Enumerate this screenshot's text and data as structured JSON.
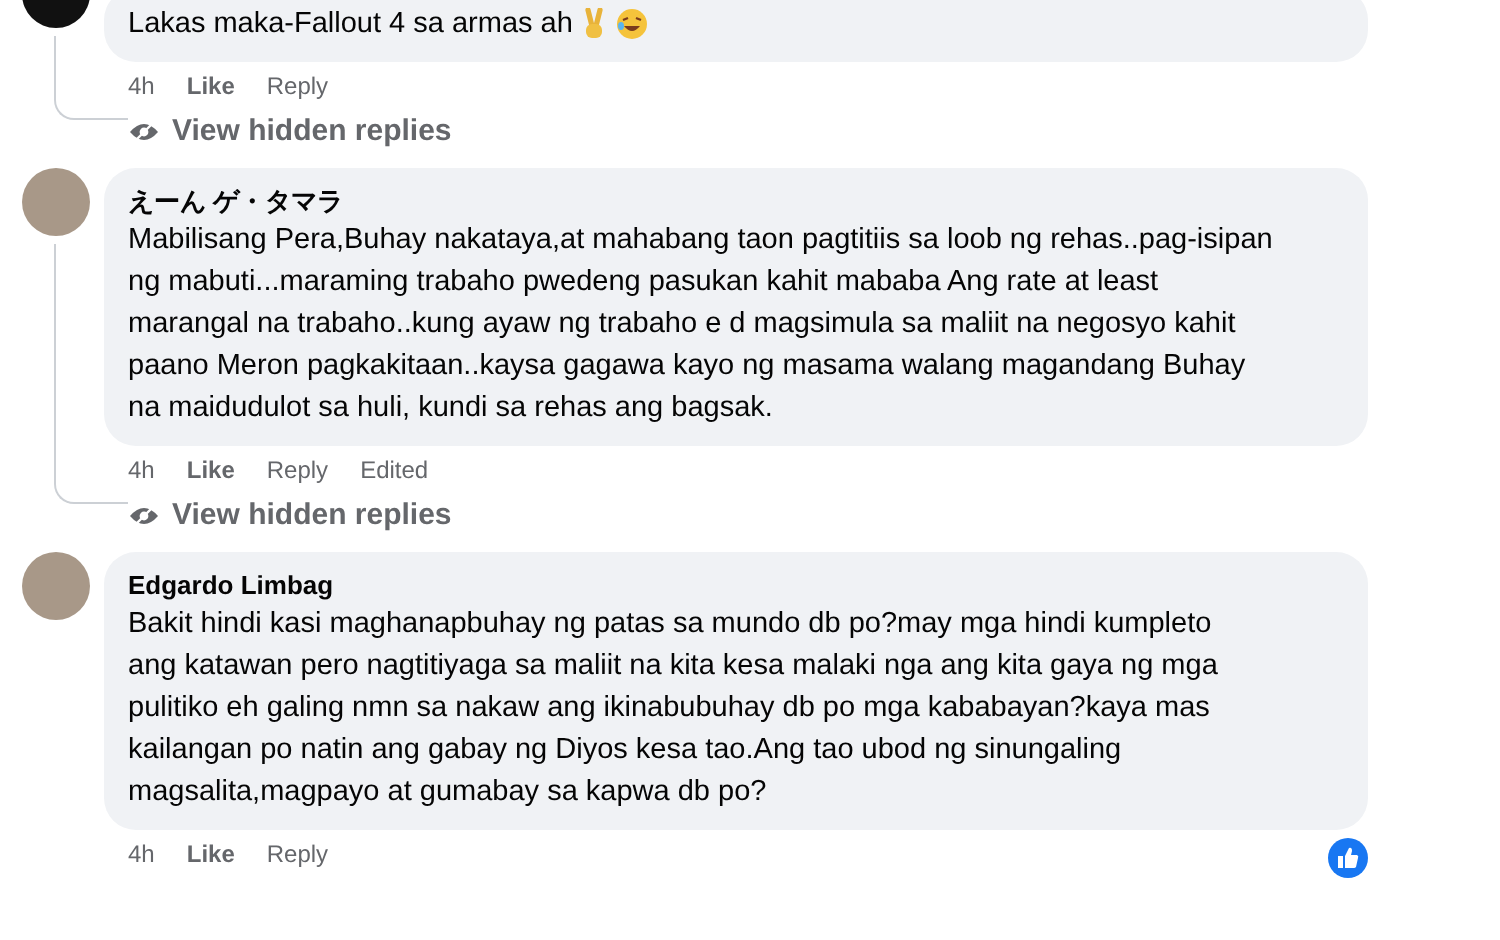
{
  "comments": [
    {
      "lines": [
        "Lakas maka-Fallout 4 sa armas ah"
      ],
      "emoji": true,
      "time": "4h",
      "like": "Like",
      "reply": "Reply",
      "hidden_replies": "View hidden replies",
      "reaction": false
    },
    {
      "author": "えーん ゲ・タマラ",
      "lines": [
        "Mabilisang Pera,Buhay nakataya,at mahabang taon pagtitiis sa loob ng rehas..pag-isipan",
        "ng mabuti...maraming trabaho pwedeng pasukan kahit mababa Ang rate at least",
        "marangal na trabaho..kung ayaw ng trabaho e d magsimula sa maliit na negosyo kahit",
        "paano Meron pagkakitaan..kaysa gagawa kayo ng masama walang magandang Buhay",
        "na maidudulot sa huli, kundi sa rehas ang bagsak."
      ],
      "emoji": false,
      "time": "4h",
      "like": "Like",
      "reply": "Reply",
      "edited": "Edited",
      "hidden_replies": "View hidden replies",
      "reaction": false
    },
    {
      "author": "Edgardo Limbag",
      "lines": [
        "Bakit hindi kasi maghanapbuhay ng patas sa mundo db po?may mga hindi kumpleto",
        "ang katawan pero nagtitiyaga sa maliit na kita kesa malaki nga ang kita gaya ng mga",
        "pulitiko eh galing nmn sa nakaw ang ikinabubuhay db po mga kababayan?kaya mas",
        "kailangan po natin ang gabay ng Diyos kesa tao.Ang tao ubod ng sinungaling",
        "magsalita,magpayo at gumabay sa kapwa db po?"
      ],
      "emoji": false,
      "time": "4h",
      "like": "Like",
      "reply": "Reply",
      "reaction": true
    }
  ]
}
